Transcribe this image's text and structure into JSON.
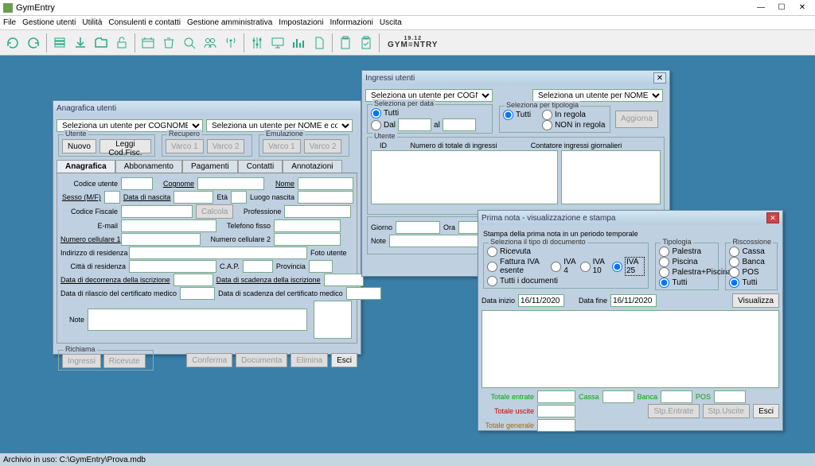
{
  "app": {
    "title": "GymEntry",
    "menu": [
      "File",
      "Gestione utenti",
      "Utilità",
      "Consulenti e contatti",
      "Gestione amministrativa",
      "Impostazioni",
      "Informazioni",
      "Uscita"
    ],
    "logo_top": "19.12",
    "logo": "GYM≡NTRY",
    "status": "Archivio in uso: C:\\GymEntry\\Prova.mdb"
  },
  "anag": {
    "title": "Anagrafica utenti",
    "sel_cognome": "Seleziona un utente per COGNOME e nome",
    "sel_nome": "Seleziona un utente per NOME e cognome",
    "gb_utente": "Utente",
    "btn_nuovo": "Nuovo",
    "btn_leggicf": "Leggi Cod.Fisc.",
    "gb_recupero": "Recupero",
    "varco1": "Varco 1",
    "varco2": "Varco 2",
    "gb_emulazione": "Emulazione",
    "tabs": [
      "Anagrafica",
      "Abbonamento",
      "Pagamenti",
      "Contatti",
      "Annotazioni"
    ],
    "f_codice": "Codice utente",
    "f_cognome": "Cognome",
    "f_nome": "Nome",
    "f_sesso": "Sesso (M/F)",
    "f_datanasc": "Data di nascita",
    "f_eta": "Età",
    "f_luogonasc": "Luogo nascita",
    "f_cf": "Codice Fiscale",
    "btn_calcola": "Calcola",
    "f_prof": "Professione",
    "f_email": "E-mail",
    "f_tel": "Telefono fisso",
    "f_cell1": "Numero cellulare 1",
    "f_cell2": "Numero cellulare 2",
    "f_indres": "Indirizzo di residenza",
    "f_foto": "Foto utente",
    "f_cittares": "Città di residenza",
    "f_cap": "C.A.P.",
    "f_prov": "Provincia",
    "f_datadec": "Data di decorrenza della iscrizione",
    "f_datascad": "Data di scadenza della iscrizione",
    "f_datacertr": "Data di rilascio del certificato medico",
    "f_datacerts": "Data di scadenza del certificato medico",
    "f_note": "Note",
    "gb_richiama": "Richiama",
    "btn_ingressi": "Ingressi",
    "btn_ricevute": "Ricevute",
    "btn_conferma": "Conferma",
    "btn_documenta": "Documenta",
    "btn_elimina": "Elimina",
    "btn_esci": "Esci"
  },
  "ingressi": {
    "title": "Ingressi utenti",
    "sel_cognome": "Seleziona un utente per COGNOME e nome",
    "sel_nome": "Seleziona un utente per NOME e cognome",
    "gb_seldata": "Seleziona per data",
    "r_tutti": "Tutti",
    "r_dal": "Dal",
    "r_al": "al",
    "gb_seltipo": "Seleziona per tipologia",
    "r_inregola": "In regola",
    "r_noninreg": "NON in regola",
    "btn_aggiorna": "Aggiorna",
    "gb_utente": "Utente",
    "lbl_id": "ID",
    "lbl_totingr": "Numero di totale di ingressi",
    "lbl_contgior": "Contatore ingressi giornalieri",
    "gb_ultimo": "",
    "lbl_giorno": "Giorno",
    "lbl_ora": "Ora",
    "lbl_note": "Note"
  },
  "prima": {
    "title": "Prima nota - visualizzazione e stampa",
    "subtitle": "Stampa della prima nota in un periodo temporale",
    "gb_tipo": "Seleziona il tipo di documento",
    "r_ricevuta": "Ricevuta",
    "r_fiva_es": "Fattura IVA esente",
    "r_iva4": "IVA 4",
    "r_iva10": "IVA 10",
    "r_iva25": "IVA 25",
    "r_tuttidoc": "Tutti i documenti",
    "gb_tipologia": "Tipologia",
    "r_palestra": "Palestra",
    "r_piscina": "Piscina",
    "r_palpisc": "Palestra+Piscina",
    "r_tutti": "Tutti",
    "gb_risc": "Riscossione",
    "r_cassa": "Cassa",
    "r_banca": "Banca",
    "r_pos": "POS",
    "lbl_datainizio": "Data inizio",
    "val_datainizio": "16/11/2020",
    "lbl_datafine": "Data fine",
    "val_datafine": "16/11/2020",
    "btn_visualizza": "Visualizza",
    "lbl_totentrate": "Totale entrate",
    "lbl_cassa": "Cassa",
    "lbl_banca": "Banca",
    "lbl_pos": "POS",
    "lbl_totuscite": "Totale uscite",
    "lbl_totgen": "Totale generale",
    "btn_stpentrate": "Stp.Entrate",
    "btn_stpuscite": "Stp.Uscite",
    "btn_esci": "Esci"
  }
}
